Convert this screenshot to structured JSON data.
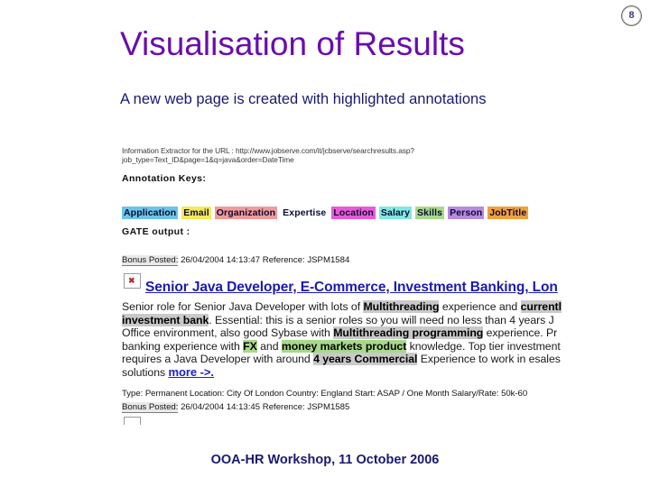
{
  "slide": {
    "number": "8",
    "title": "Visualisation of Results",
    "subtitle": "A new web page is created with highlighted annotations",
    "footer": "OOA-HR Workshop, 11 October 2006",
    "title_color": "#6a0dad",
    "subtitle_color": "#191970",
    "footer_color": "#191970"
  },
  "screenshot": {
    "url_line_1": "Information Extractor for the URL : http://www.jobserve.com/it/jcbserve/searchresults.asp?",
    "url_line_2": "job_type=Text_ID&page=1&q=java&order=DateTime",
    "annotation_keys_label": "Annotation Keys:",
    "annotation_keys": [
      {
        "label": "Application",
        "color": "#6cc4e8"
      },
      {
        "label": "Email",
        "color": "#f5e85a"
      },
      {
        "label": "Organization",
        "color": "#f29a9a"
      },
      {
        "label": "Expertise",
        "color": "#ffffff"
      },
      {
        "label": "Location",
        "color": "#e85ad8"
      },
      {
        "label": "Salary",
        "color": "#7fe8e0"
      },
      {
        "label": "Skills",
        "color": "#a8d98a"
      },
      {
        "label": "Person",
        "color": "#b88ae0"
      },
      {
        "label": "JobTitle",
        "color": "#f0a03c"
      }
    ],
    "gate_output_label": "GATE output :",
    "posting_1": {
      "key_label": "Bonus Posted:",
      "timestamp": "26/04/2004 14:13:47",
      "reference_label": "Reference:",
      "reference": "JSPM1584",
      "headline": "Senior Java Developer, E-Commerce, Investment Banking, Lon",
      "body_segments": [
        {
          "text": "Senior role for Senior Java Developer with lots of ",
          "style": "plain"
        },
        {
          "text": "Multithreading",
          "style": "grey"
        },
        {
          "text": " experience and ",
          "style": "plain"
        },
        {
          "text": "currentl",
          "style": "grey"
        },
        {
          "text": "\n",
          "style": "break"
        },
        {
          "text": "investment bank",
          "style": "grey"
        },
        {
          "text": ". Essential: this is a senior roles so you will need no less than 4 years J",
          "style": "plain"
        },
        {
          "text": "\n",
          "style": "break"
        },
        {
          "text": "Office environment, also good Sybase with ",
          "style": "plain"
        },
        {
          "text": "Multithreading programming",
          "style": "grey"
        },
        {
          "text": " experience. Pr",
          "style": "plain"
        },
        {
          "text": "\n",
          "style": "break"
        },
        {
          "text": "banking experience with ",
          "style": "plain"
        },
        {
          "text": "FX",
          "style": "green"
        },
        {
          "text": " and ",
          "style": "plain"
        },
        {
          "text": "money markets product",
          "style": "green"
        },
        {
          "text": " knowledge. Top tier investment",
          "style": "plain"
        },
        {
          "text": "\n",
          "style": "break"
        },
        {
          "text": "requires a Java Developer with around ",
          "style": "plain"
        },
        {
          "text": "4 years Commercial",
          "style": "grey"
        },
        {
          "text": " Experience to work in esales",
          "style": "plain"
        },
        {
          "text": "\n",
          "style": "break"
        },
        {
          "text": "solutions ",
          "style": "plain"
        },
        {
          "text": "more ->.",
          "style": "link"
        }
      ],
      "meta": "Type: Permanent Location:  City Of London Country:  England Start:  ASAP / One Month Salary/Rate:  50k-60"
    },
    "posting_2": {
      "key_label": "Bonus Posted:",
      "timestamp": "26/04/2004 14:13:45",
      "reference_label": "Reference:",
      "reference": "JSPM1585"
    }
  }
}
